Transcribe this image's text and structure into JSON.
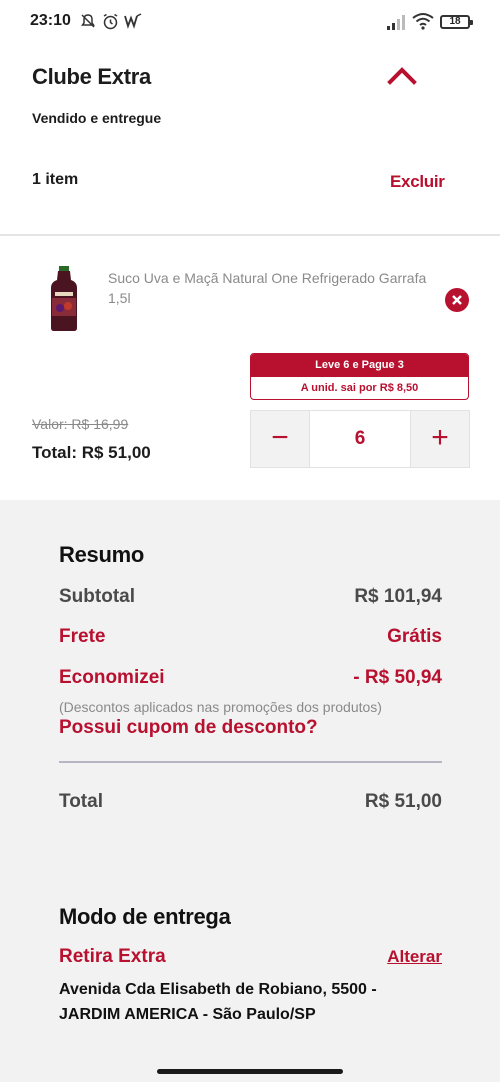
{
  "status_bar": {
    "time": "23:10",
    "battery": "18",
    "icons": [
      "notifications-off-icon",
      "alarm-icon",
      "app-icon",
      "signal-icon",
      "wifi-icon",
      "battery-icon"
    ]
  },
  "cart": {
    "store_name": "Clube Extra",
    "sold_by": "Vendido e entregue",
    "item_count": "1 item",
    "delete_label": "Excluir"
  },
  "product": {
    "name": "Suco Uva e Maçã Natural One Refrigerado Garrafa 1,5l",
    "promo_title": "Leve 6 e Pague 3",
    "unit_label": "A unid. sai por",
    "unit_price": "R$ 8,50",
    "old_price": "Valor: R$ 16,99",
    "total": "Total: R$ 51,00",
    "quantity": "6",
    "decrement": "−",
    "increment": "+"
  },
  "summary": {
    "title": "Resumo",
    "subtotal_label": "Subtotal",
    "subtotal_value": "R$ 101,94",
    "shipping_label": "Frete",
    "shipping_value": "Grátis",
    "savings_label": "Economizei",
    "savings_value": "- R$ 50,94",
    "savings_note": "(Descontos aplicados nas promoções dos produtos)",
    "coupon_link": "Possui cupom de desconto?",
    "total_label": "Total",
    "total_value": "R$ 51,00"
  },
  "delivery": {
    "title": "Modo de entrega",
    "type": "Retira Extra",
    "change_label": "Alterar",
    "address": "Avenida Cda Elisabeth de Robiano, 5500 - JARDIM AMERICA - São Paulo/SP"
  },
  "colors": {
    "brand_red": "#b8102f",
    "panel_bg": "#f2f2f2",
    "muted_text": "#8a8a8a"
  }
}
